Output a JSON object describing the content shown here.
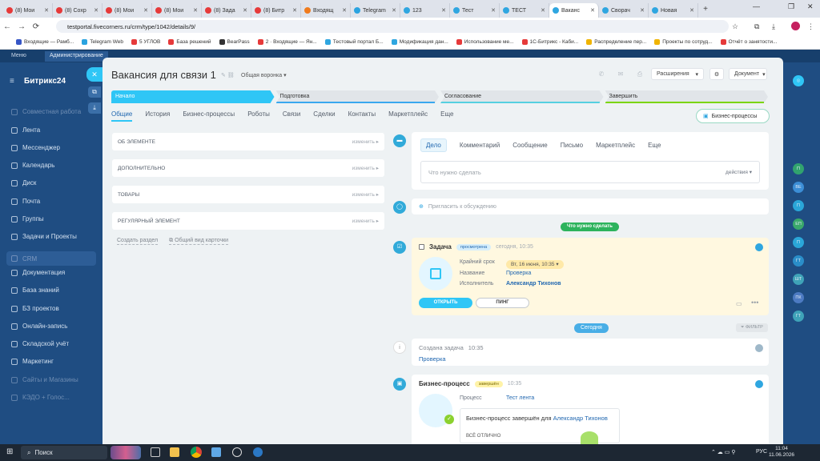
{
  "browser": {
    "tabs": [
      {
        "label": "(8) Мои",
        "color": "#e63a3a"
      },
      {
        "label": "(8) Сохр",
        "color": "#e63a3a"
      },
      {
        "label": "(8) Мои",
        "color": "#e63a3a"
      },
      {
        "label": "(8) Мои",
        "color": "#e63a3a"
      },
      {
        "label": "(8) Зада",
        "color": "#e63a3a"
      },
      {
        "label": "(8) Битр",
        "color": "#e63a3a"
      },
      {
        "label": "Входящ",
        "color": "#f07b1d"
      },
      {
        "label": "Telegram",
        "color": "#2aa3e0"
      },
      {
        "label": "123",
        "color": "#2fa6e0"
      },
      {
        "label": "Тест",
        "color": "#2fa6e0"
      },
      {
        "label": "ТЕСТ",
        "color": "#2fa6e0"
      },
      {
        "label": "Ваканс",
        "color": "#2fa6e0"
      },
      {
        "label": "Сворач",
        "color": "#2fa6e0"
      },
      {
        "label": "Новая",
        "color": "#2fa6e0"
      }
    ],
    "url": "testportal.fivecorners.ru/crm/type/1042/details/9/",
    "bookmarks": [
      {
        "label": "Входящие — Рамб...",
        "color": "#3656c6"
      },
      {
        "label": "Telegram Web",
        "color": "#2aa3e0"
      },
      {
        "label": "5 УГЛОВ",
        "color": "#e63a3a"
      },
      {
        "label": "База решений",
        "color": "#e63a3a"
      },
      {
        "label": "BearPass",
        "color": "#333333"
      },
      {
        "label": "2 · Входящие — Ян...",
        "color": "#e63a3a"
      },
      {
        "label": "Тестовый портал Б...",
        "color": "#2fa6e0"
      },
      {
        "label": "Модификация дан...",
        "color": "#2fa6e0"
      },
      {
        "label": "Использование ме...",
        "color": "#e63a3a"
      },
      {
        "label": "1С-Битрикс - Каби...",
        "color": "#e63a3a"
      },
      {
        "label": "Распределение пер...",
        "color": "#f0b400"
      },
      {
        "label": "Проекты по сотруд...",
        "color": "#f0b400"
      },
      {
        "label": "Отчёт о занятости...",
        "color": "#e63a3a"
      }
    ]
  },
  "portal": {
    "menu_label": "Меню",
    "admin_label": "Администрирование",
    "logo": "Битрикс24",
    "sidebar": [
      {
        "label": "Совместная работа",
        "dim": true
      },
      {
        "label": "Лента",
        "dim": false
      },
      {
        "label": "Мессенджер",
        "dim": false
      },
      {
        "label": "Календарь",
        "dim": false
      },
      {
        "label": "Диск",
        "dim": false
      },
      {
        "label": "Почта",
        "dim": false
      },
      {
        "label": "Группы",
        "dim": false
      },
      {
        "label": "Задачи и Проекты",
        "dim": false
      },
      {
        "label": "CRM",
        "dim": false
      },
      {
        "label": "Документация",
        "dim": false
      },
      {
        "label": "База знаний",
        "dim": false
      },
      {
        "label": "БЗ проектов",
        "dim": false
      },
      {
        "label": "Онлайн-запись",
        "dim": false
      },
      {
        "label": "Складской учёт",
        "dim": false
      },
      {
        "label": "Маркетинг",
        "dim": false
      },
      {
        "label": "Сайты и Магазины",
        "dim": true
      },
      {
        "label": "КЭДО + Голос...",
        "dim": true
      }
    ],
    "right_avatars": [
      "П",
      "ВЕ",
      "П",
      "ЕП",
      "П",
      "ГТ",
      "ШТ",
      "ПК",
      "ГТ"
    ]
  },
  "card": {
    "title": "Вакансия для связи 1",
    "funnel": "Общая воронка",
    "extensions_btn": "Расширения",
    "document_btn": "Документ",
    "stages": [
      {
        "label": "Начало",
        "color": "#2fc6f6",
        "active": true
      },
      {
        "label": "Подготовка",
        "color": "#39a8ef",
        "active": false
      },
      {
        "label": "Согласование",
        "color": "#55d0e0",
        "active": false
      },
      {
        "label": "Завершить",
        "color": "#7bd500",
        "active": false
      }
    ],
    "tabs": [
      "Общие",
      "История",
      "Бизнес-процессы",
      "Роботы",
      "Связи",
      "Сделки",
      "Контакты",
      "Маркетплейс",
      "Еще"
    ],
    "bp_button": "Бизнес-процессы",
    "sections": [
      {
        "label": "Об элементе",
        "action": "изменить"
      },
      {
        "label": "Дополнительно",
        "action": "изменить"
      },
      {
        "label": "Товары",
        "action": "изменить"
      },
      {
        "label": "Регулярный элемент",
        "action": "изменить"
      }
    ],
    "create_section": "Создать раздел",
    "common_view": "Общий вид карточки"
  },
  "timeline": {
    "composer_tabs": [
      "Дело",
      "Комментарий",
      "Сообщение",
      "Письмо",
      "Маркетплейс",
      "Еще"
    ],
    "composer_placeholder": "Что нужно сделать",
    "composer_actions": "действия",
    "invite": "Пригласить к обсуждению",
    "todo_pill": "Что нужно сделать",
    "task": {
      "title": "Задача",
      "status": "просмотрена",
      "time": "сегодня, 10:35",
      "deadline_label": "Крайний срок",
      "deadline_value": "Вт, 16 июня, 10:35",
      "name_label": "Название",
      "name_value": "Проверка",
      "assignee_label": "Исполнитель",
      "assignee_value": "Александр Тихонов",
      "open_btn": "ОТКРЫТЬ",
      "ping_btn": "ПИНГ"
    },
    "today_pill": "Сегодня",
    "filter": "ФИЛЬТР",
    "created": {
      "title": "Создана задача",
      "time": "10:35",
      "link": "Проверка"
    },
    "bp": {
      "title": "Бизнес-процесс",
      "status": "завершён",
      "time": "10:35",
      "process_label": "Процесс",
      "process_value": "Тест лента",
      "message_prefix": "Бизнес-процесс завершён для",
      "message_user": "Александр Тихонов",
      "sub": "ВСЁ ОТЛИЧНО"
    }
  },
  "taskbar": {
    "search": "Поиск",
    "lang": "РУС",
    "time": "11:04",
    "date": "11.06.2026"
  }
}
